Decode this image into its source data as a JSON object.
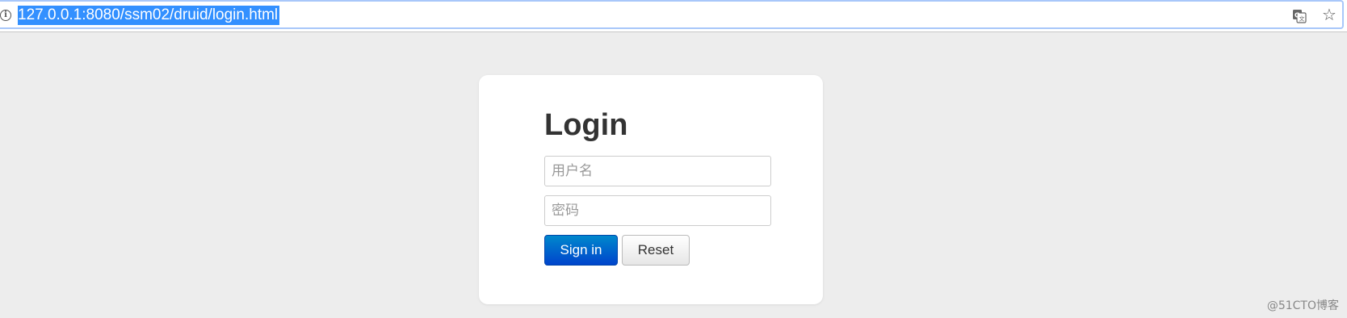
{
  "browser": {
    "url": "127.0.0.1:8080/ssm02/druid/login.html",
    "info_icon_glyph": "i",
    "translate_icon": "translate-icon",
    "bookmark_icon": "star-icon",
    "bookmark_glyph": "☆"
  },
  "login": {
    "title": "Login",
    "username_placeholder": "用户名",
    "password_placeholder": "密码",
    "sign_in_label": "Sign in",
    "reset_label": "Reset"
  },
  "colors": {
    "page_background": "#ededed",
    "url_highlight": "#3390ff",
    "primary_button": "#0055cc"
  },
  "watermark": "@51CTO博客"
}
